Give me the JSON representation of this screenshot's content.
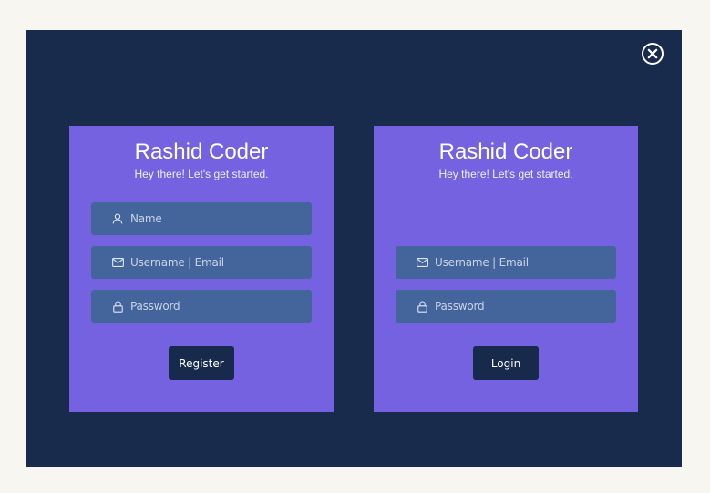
{
  "colors": {
    "page_bg": "#f8f6f1",
    "modal_bg": "#182b4c",
    "card_bg": "#7462e0",
    "field_bg": "#44659c",
    "button_bg": "#172a4b"
  },
  "modal": {
    "close_icon": "close-circle-x"
  },
  "register": {
    "title": "Rashid Coder",
    "subtitle": "Hey there! Let's get started.",
    "name_placeholder": "Name",
    "name_icon": "user",
    "email_placeholder": "Username | Email",
    "email_icon": "envelope",
    "password_placeholder": "Password",
    "password_icon": "lock",
    "button_label": "Register"
  },
  "login": {
    "title": "Rashid Coder",
    "subtitle": "Hey there! Let's get started.",
    "email_placeholder": "Username | Email",
    "email_icon": "envelope",
    "password_placeholder": "Password",
    "password_icon": "lock",
    "button_label": "Login"
  }
}
